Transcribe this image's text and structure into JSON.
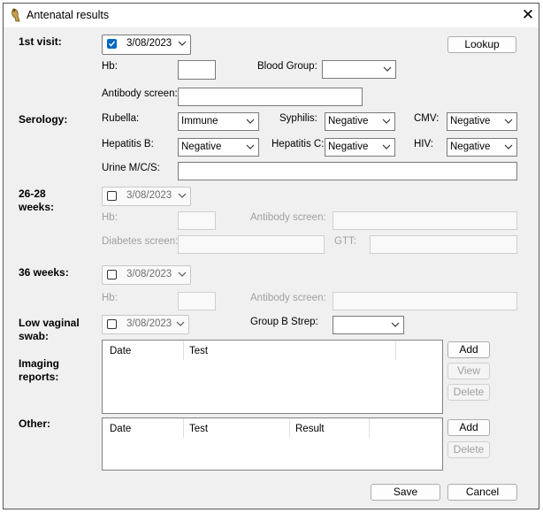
{
  "window": {
    "title": "Antenatal results",
    "icon": "horn-icon"
  },
  "visit1": {
    "section": "1st visit:",
    "date": "3/08/2023",
    "lookup": "Lookup",
    "hb_label": "Hb:",
    "blood_group_label": "Blood Group:",
    "antibody_label": "Antibody screen:"
  },
  "serology": {
    "section": "Serology:",
    "rubella_label": "Rubella:",
    "rubella_value": "Immune",
    "syphilis_label": "Syphilis:",
    "syphilis_value": "Negative",
    "cmv_label": "CMV:",
    "cmv_value": "Negative",
    "hepb_label": "Hepatitis B:",
    "hepb_value": "Negative",
    "hepc_label": "Hepatitis C:",
    "hepc_value": "Negative",
    "hiv_label": "HIV:",
    "hiv_value": "Negative",
    "urine_label": "Urine M/C/S:"
  },
  "weeks26": {
    "section_line1": "26-28",
    "section_line2": "weeks:",
    "date": "3/08/2023",
    "hb_label": "Hb:",
    "antibody_label": "Antibody screen:",
    "diabetes_label": "Diabetes screen:",
    "gtt_label": "GTT:"
  },
  "weeks36": {
    "section": "36 weeks:",
    "date": "3/08/2023",
    "hb_label": "Hb:",
    "antibody_label": "Antibody screen:"
  },
  "swab": {
    "section_line1": "Low vaginal",
    "section_line2": "swab:",
    "date": "3/08/2023",
    "gbs_label": "Group B Strep:"
  },
  "imaging": {
    "section_line1": "Imaging",
    "section_line2": "reports:",
    "columns": [
      "Date",
      "Test"
    ],
    "add": "Add",
    "view": "View",
    "delete": "Delete"
  },
  "other": {
    "section": "Other:",
    "columns": [
      "Date",
      "Test",
      "Result"
    ],
    "add": "Add",
    "delete": "Delete"
  },
  "footer": {
    "save": "Save",
    "cancel": "Cancel"
  },
  "colors": {
    "accent": "#0067c0",
    "disabled_text": "#a0a0a0"
  }
}
